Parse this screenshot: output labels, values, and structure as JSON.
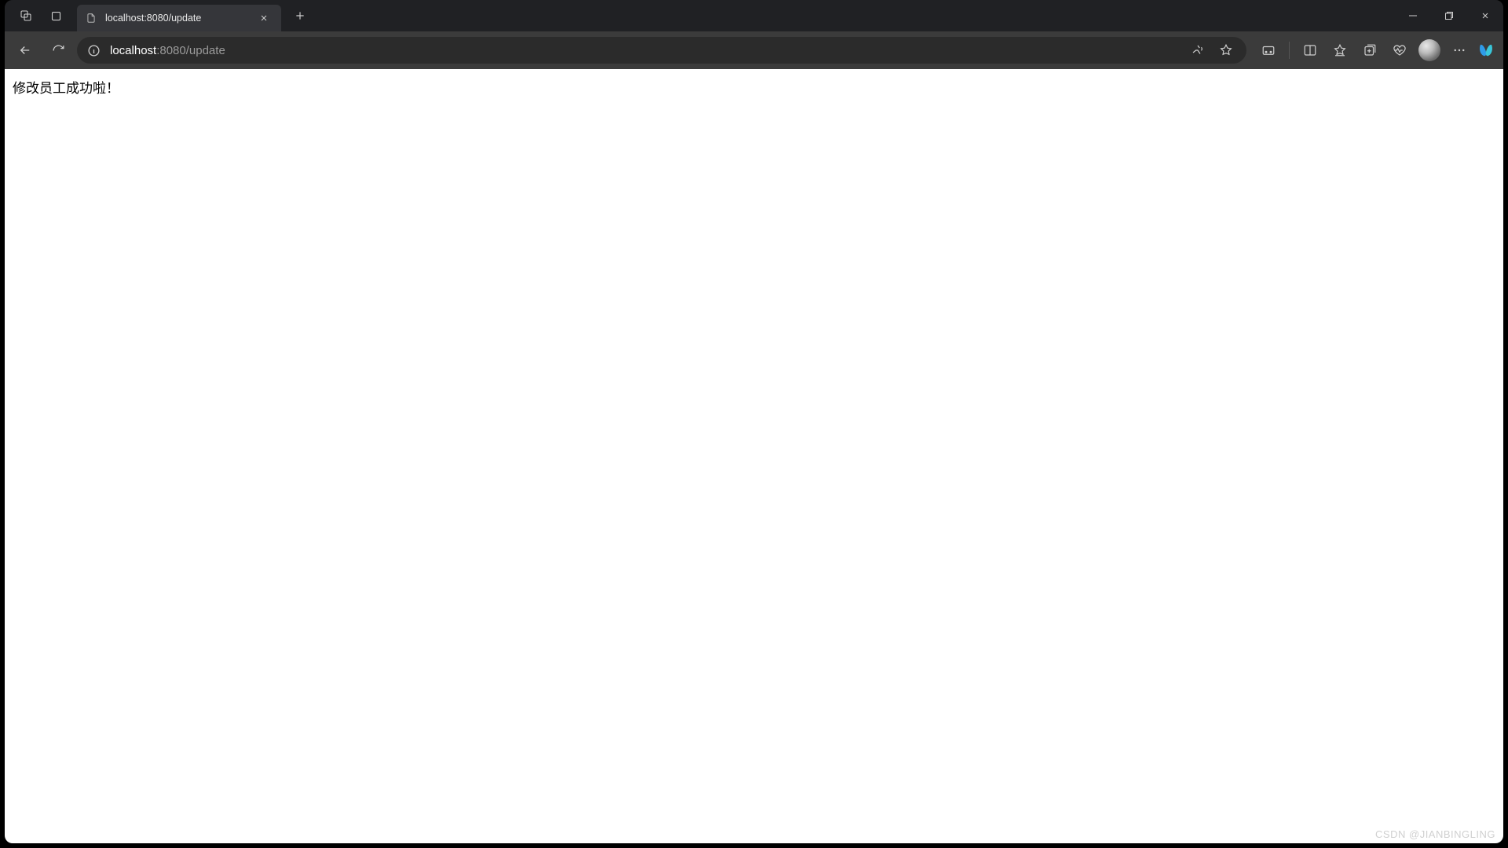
{
  "tab": {
    "title": "localhost:8080/update"
  },
  "address": {
    "host": "localhost",
    "rest": ":8080/update"
  },
  "page": {
    "message": "修改员工成功啦！"
  },
  "watermark": "CSDN @JIANBINGLING"
}
